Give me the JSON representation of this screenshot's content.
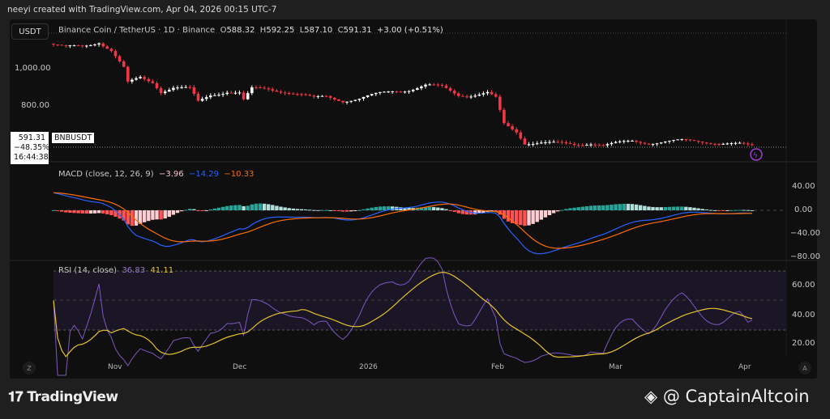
{
  "header": {
    "credit": "neeyi created with TradingView.com, Apr 04, 2026 00:15 UTC-7"
  },
  "symbol_button": "USDT",
  "legend": {
    "name": "Binance Coin / TetherUS · 1D · Binance",
    "o_label": "O",
    "o": "588.32",
    "h_label": "H",
    "h": "592.25",
    "l_label": "L",
    "l": "587.10",
    "c_label": "C",
    "c": "591.31",
    "change": "+3.00 (+0.51%)"
  },
  "price_box": {
    "price": "591.31",
    "change_pct": "−48.35%",
    "countdown": "16:44:38",
    "symbol": "BNBUSDT"
  },
  "price_axis": [
    "1,000.00",
    "800.00"
  ],
  "macd": {
    "label": "MACD (close, 12, 26, 9)",
    "hist": "−3.96",
    "macd": "−14.29",
    "signal": "−10.33",
    "axis": [
      "40.00",
      "0.00",
      "−40.00",
      "−80.00"
    ]
  },
  "rsi": {
    "label": "RSI (14, close)",
    "rsi": "36.83",
    "ma": "41.11",
    "axis": [
      "60.00",
      "40.00",
      "20.00"
    ]
  },
  "time_axis": [
    "Nov",
    "Dec",
    "2026",
    "Feb",
    "Mar",
    "Apr"
  ],
  "buttons": {
    "zoom": "Z",
    "auto": "A"
  },
  "footer": {
    "brand": "TradingView",
    "watermark": "@ CaptainAltcoin"
  },
  "colors": {
    "up": "#ffffff",
    "down": "#f23645",
    "macd": "#2962ff",
    "signal": "#ff6d00",
    "rsi": "#7e57c2",
    "rsi_ma": "#e6c229",
    "hist_pos": "#26a69a",
    "hist_neg": "#ff5252"
  },
  "chart_data": {
    "type": "candlestick",
    "start_date": "2025-10-17",
    "end_date": "2026-04-04",
    "close_keypoints": [
      [
        0,
        1130
      ],
      [
        3,
        1110
      ],
      [
        7,
        1120
      ],
      [
        11,
        1150
      ],
      [
        14,
        1100
      ],
      [
        17,
        1000
      ],
      [
        18,
        920
      ],
      [
        21,
        950
      ],
      [
        24,
        930
      ],
      [
        26,
        880
      ],
      [
        29,
        900
      ],
      [
        33,
        890
      ],
      [
        35,
        820
      ],
      [
        38,
        860
      ],
      [
        42,
        880
      ],
      [
        45,
        870
      ],
      [
        46,
        830
      ],
      [
        48,
        890
      ],
      [
        52,
        890
      ],
      [
        56,
        880
      ],
      [
        60,
        860
      ],
      [
        63,
        840
      ],
      [
        66,
        850
      ],
      [
        70,
        830
      ],
      [
        74,
        840
      ],
      [
        78,
        860
      ],
      [
        82,
        880
      ],
      [
        86,
        890
      ],
      [
        90,
        910
      ],
      [
        94,
        900
      ],
      [
        98,
        860
      ],
      [
        101,
        860
      ],
      [
        105,
        870
      ],
      [
        107,
        840
      ],
      [
        109,
        700
      ],
      [
        112,
        660
      ],
      [
        114,
        600
      ],
      [
        118,
        605
      ],
      [
        122,
        600
      ],
      [
        126,
        590
      ],
      [
        130,
        600
      ],
      [
        133,
        590
      ],
      [
        136,
        600
      ],
      [
        140,
        610
      ],
      [
        144,
        600
      ],
      [
        148,
        610
      ],
      [
        152,
        615
      ],
      [
        155,
        610
      ],
      [
        158,
        605
      ],
      [
        162,
        600
      ],
      [
        166,
        595
      ],
      [
        168,
        588
      ],
      [
        169,
        591.31
      ]
    ]
  }
}
